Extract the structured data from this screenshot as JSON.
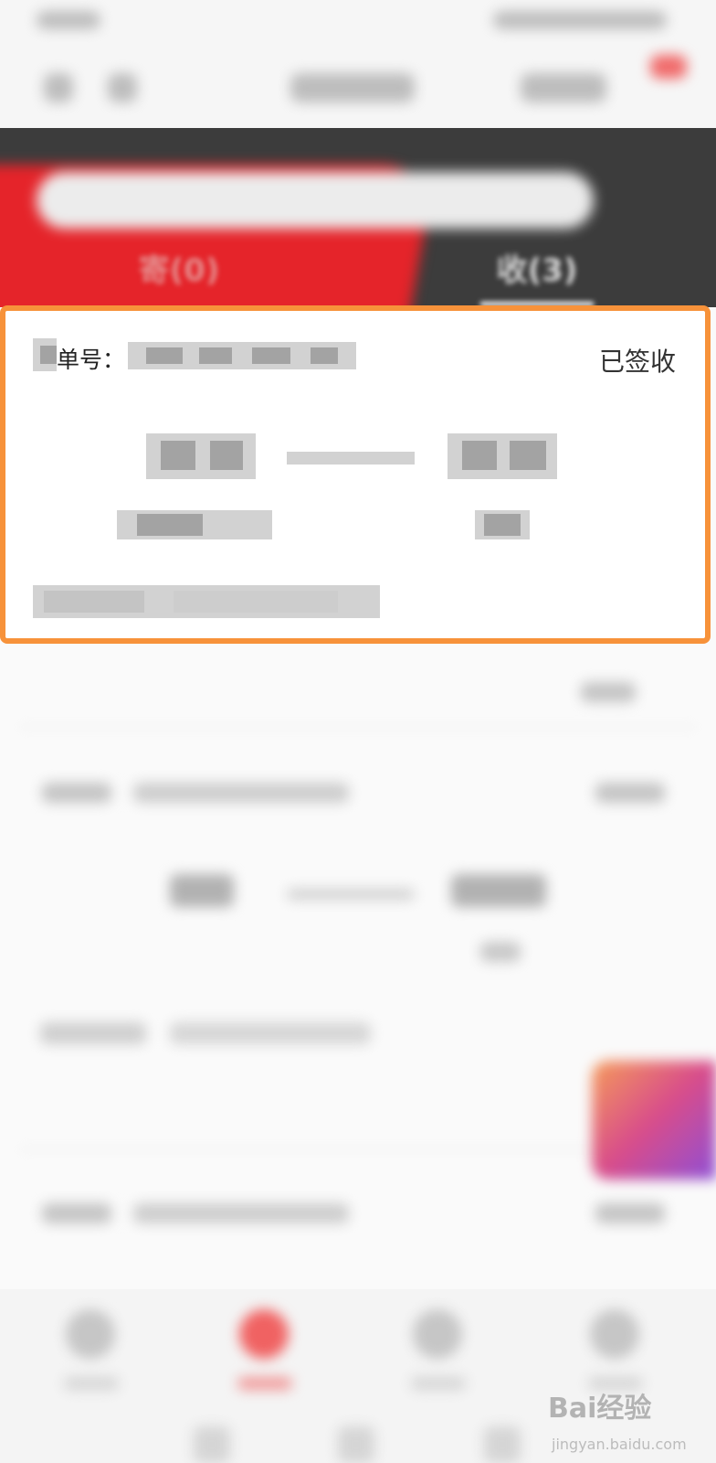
{
  "tabs": [
    {
      "label": "寄(0)"
    },
    {
      "label": "收(3)"
    }
  ],
  "card": {
    "tracking_label": "单号：",
    "status": "已签收"
  },
  "watermark": {
    "brand": "Bai经验",
    "site": "jingyan.baidu.com"
  },
  "colors": {
    "brand_red": "#e5242a",
    "highlight_orange": "#f7923a",
    "header_dark": "#3c3c3c"
  }
}
